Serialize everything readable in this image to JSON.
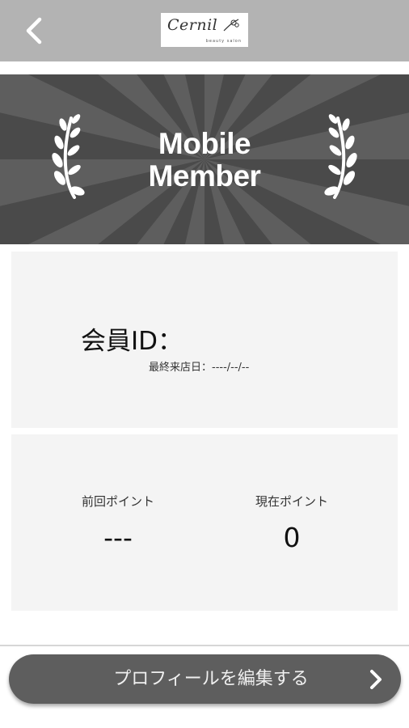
{
  "header": {
    "back_icon": "chevron-left-icon",
    "logo_text": "Cernil",
    "logo_subtext": "beauty salon"
  },
  "banner": {
    "title_line1": "Mobile",
    "title_line2": "Member",
    "left_icon": "laurel-branch-icon",
    "right_icon": "laurel-branch-icon"
  },
  "member_card": {
    "id_label": "会員ID：",
    "last_visit": "最終来店日：----/--/--"
  },
  "points_card": {
    "previous_label": "前回ポイント",
    "previous_value": "---",
    "current_label": "現在ポイント",
    "current_value": "0"
  },
  "edit_button": {
    "label": "プロフィールを編集する",
    "icon": "chevron-right-icon"
  },
  "colors": {
    "header_bg": "#b3b3b3",
    "banner_bg": "#5e5e5e",
    "card_bg": "#f4f4f4",
    "button_bg": "#5e5e5e"
  }
}
